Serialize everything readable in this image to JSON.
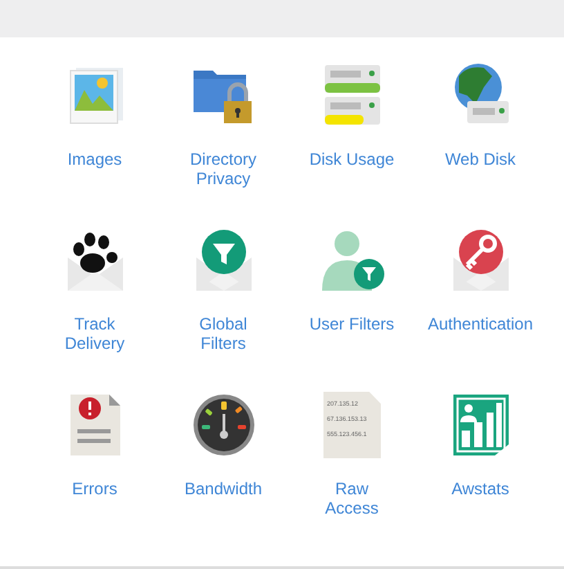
{
  "rows": [
    {
      "items": [
        {
          "label": "Images",
          "kind": "images"
        },
        {
          "label": "Directory Privacy",
          "kind": "folder-lock"
        },
        {
          "label": "Disk Usage",
          "kind": "disk"
        },
        {
          "label": "Web Disk",
          "kind": "webdisk"
        }
      ]
    },
    {
      "items": [
        {
          "label": "Track Delivery",
          "kind": "paw"
        },
        {
          "label": "Global Filters",
          "kind": "mail-filter"
        },
        {
          "label": "User Filters",
          "kind": "user-filter"
        },
        {
          "label": "Authentication",
          "kind": "mail-key"
        }
      ]
    },
    {
      "items": [
        {
          "label": "Errors",
          "kind": "errors"
        },
        {
          "label": "Bandwidth",
          "kind": "gauge"
        },
        {
          "label": "Raw Access",
          "kind": "log",
          "icon_text": [
            "207.135.12",
            "67.136.153.13",
            "555.123.456.1"
          ]
        },
        {
          "label": "Awstats",
          "kind": "awstats"
        }
      ]
    }
  ]
}
